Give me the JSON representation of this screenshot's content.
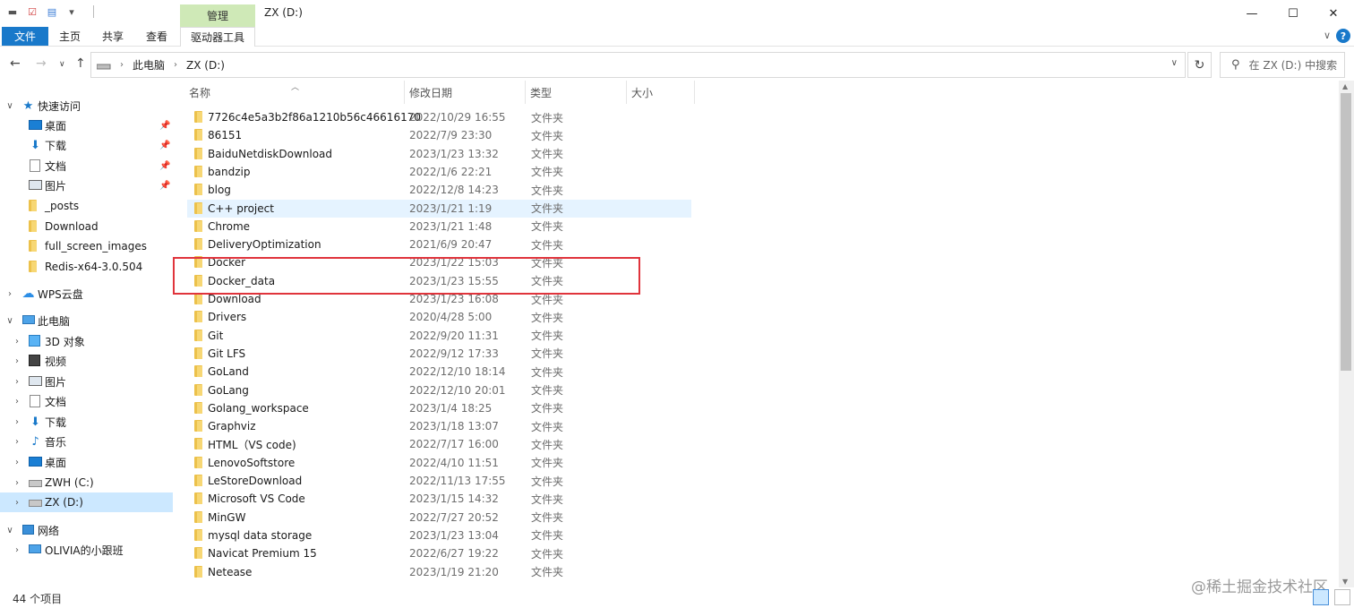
{
  "window": {
    "title": "ZX (D:)",
    "manage_tab": "管理",
    "minimize": "—",
    "maximize": "☐",
    "close": "✕"
  },
  "ribbon": {
    "tabs": [
      "文件",
      "主页",
      "共享",
      "查看",
      "驱动器工具"
    ]
  },
  "address": {
    "crumbs": [
      "此电脑",
      "ZX (D:)"
    ],
    "search_placeholder": "在 ZX (D:) 中搜索"
  },
  "nav": {
    "quick_access": "快速访问",
    "quick_items": [
      "桌面",
      "下载",
      "文档",
      "图片",
      "_posts",
      "Download",
      "full_screen_images",
      "Redis-x64-3.0.504"
    ],
    "wps": "WPS云盘",
    "this_pc": "此电脑",
    "pc_items": [
      "3D 对象",
      "视频",
      "图片",
      "文档",
      "下载",
      "音乐",
      "桌面",
      "ZWH (C:)",
      "ZX (D:)"
    ],
    "network": "网络",
    "network_items": [
      "OLIVIA的小跟班"
    ]
  },
  "columns": [
    "名称",
    "修改日期",
    "类型",
    "大小"
  ],
  "files": [
    {
      "name": "7726c4e5a3b2f86a1210b56c46616170",
      "date": "2022/10/29 16:55",
      "type": "文件夹"
    },
    {
      "name": "86151",
      "date": "2022/7/9 23:30",
      "type": "文件夹"
    },
    {
      "name": "BaiduNetdiskDownload",
      "date": "2023/1/23 13:32",
      "type": "文件夹"
    },
    {
      "name": "bandzip",
      "date": "2022/1/6 22:21",
      "type": "文件夹"
    },
    {
      "name": "blog",
      "date": "2022/12/8 14:23",
      "type": "文件夹"
    },
    {
      "name": "C++ project",
      "date": "2023/1/21 1:19",
      "type": "文件夹"
    },
    {
      "name": "Chrome",
      "date": "2023/1/21 1:48",
      "type": "文件夹"
    },
    {
      "name": "DeliveryOptimization",
      "date": "2021/6/9 20:47",
      "type": "文件夹"
    },
    {
      "name": "Docker",
      "date": "2023/1/22 15:03",
      "type": "文件夹"
    },
    {
      "name": "Docker_data",
      "date": "2023/1/23 15:55",
      "type": "文件夹"
    },
    {
      "name": "Download",
      "date": "2023/1/23 16:08",
      "type": "文件夹"
    },
    {
      "name": "Drivers",
      "date": "2020/4/28 5:00",
      "type": "文件夹"
    },
    {
      "name": "Git",
      "date": "2022/9/20 11:31",
      "type": "文件夹"
    },
    {
      "name": "Git LFS",
      "date": "2022/9/12 17:33",
      "type": "文件夹"
    },
    {
      "name": "GoLand",
      "date": "2022/12/10 18:14",
      "type": "文件夹"
    },
    {
      "name": "GoLang",
      "date": "2022/12/10 20:01",
      "type": "文件夹"
    },
    {
      "name": "Golang_workspace",
      "date": "2023/1/4 18:25",
      "type": "文件夹"
    },
    {
      "name": "Graphviz",
      "date": "2023/1/18 13:07",
      "type": "文件夹"
    },
    {
      "name": "HTML（VS code)",
      "date": "2022/7/17 16:00",
      "type": "文件夹"
    },
    {
      "name": "LenovoSoftstore",
      "date": "2022/4/10 11:51",
      "type": "文件夹"
    },
    {
      "name": "LeStoreDownload",
      "date": "2022/11/13 17:55",
      "type": "文件夹"
    },
    {
      "name": "Microsoft VS Code",
      "date": "2023/1/15 14:32",
      "type": "文件夹"
    },
    {
      "name": "MinGW",
      "date": "2022/7/27 20:52",
      "type": "文件夹"
    },
    {
      "name": "mysql data storage",
      "date": "2023/1/23 13:04",
      "type": "文件夹"
    },
    {
      "name": "Navicat Premium 15",
      "date": "2022/6/27 19:22",
      "type": "文件夹"
    },
    {
      "name": "Netease",
      "date": "2023/1/19 21:20",
      "type": "文件夹"
    }
  ],
  "status": {
    "count": "44 个项目",
    "watermark": "@稀土掘金技术社区"
  }
}
